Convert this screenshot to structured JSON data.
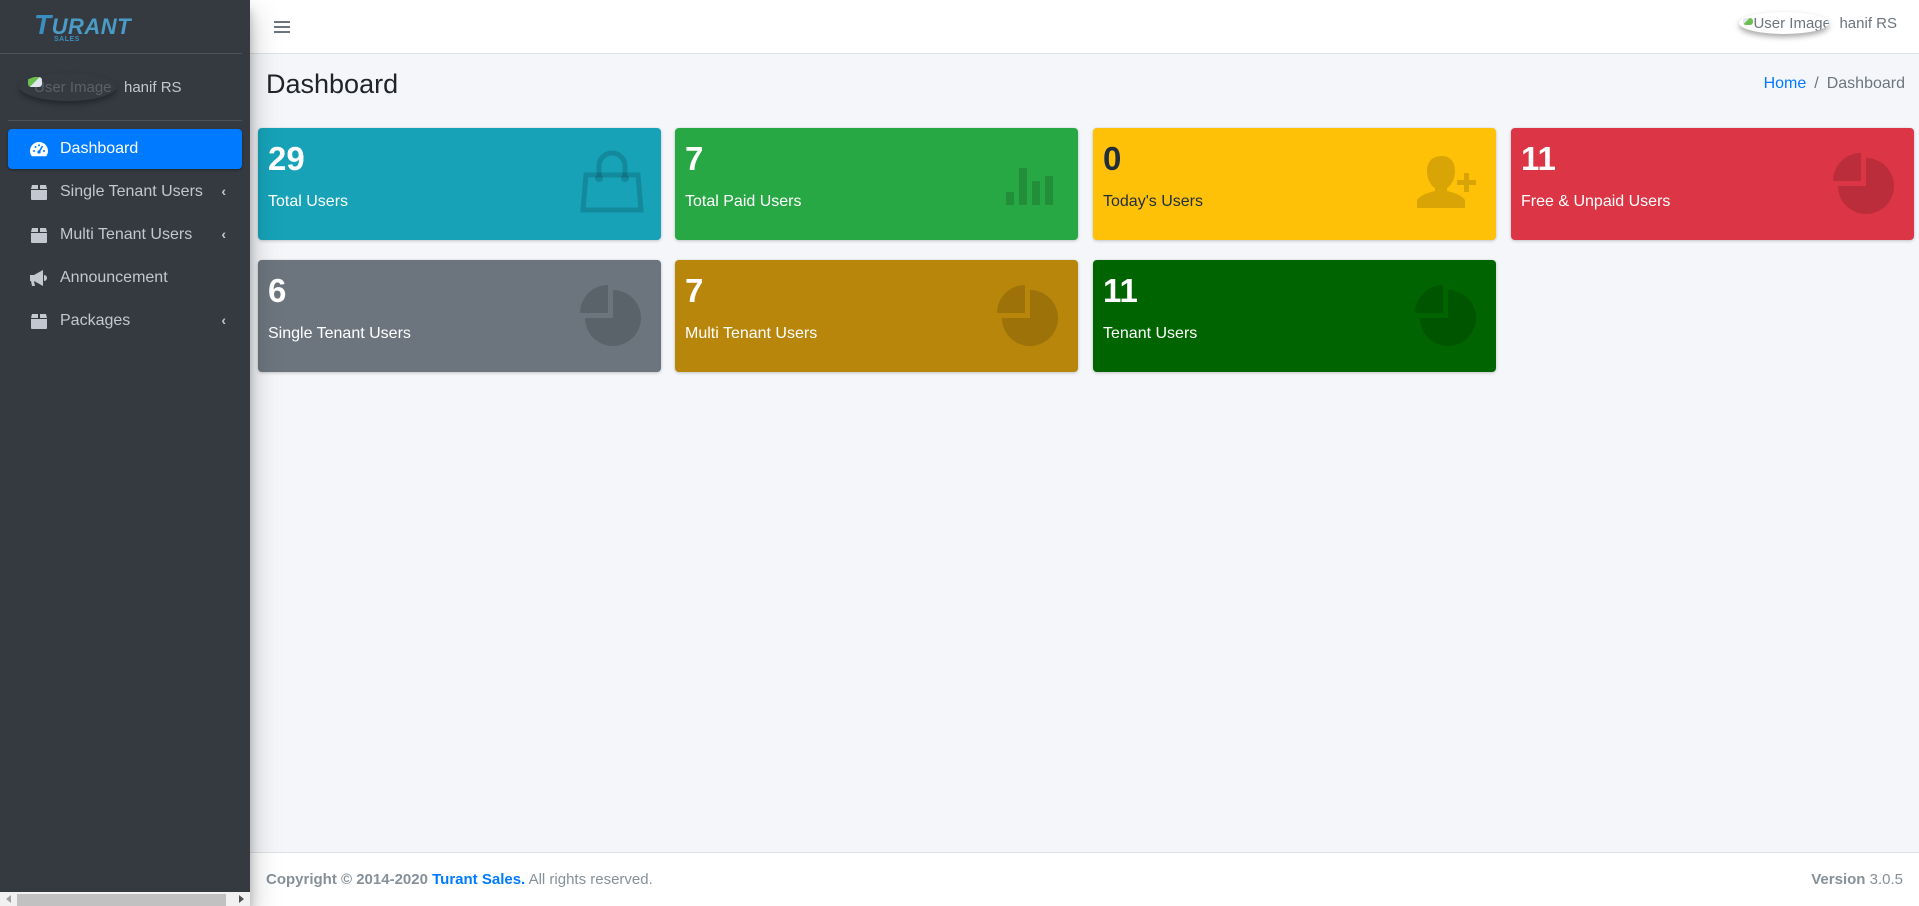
{
  "brand": {
    "name": "TURANT",
    "sub": "SALES"
  },
  "user": {
    "image_alt": "User Image",
    "name": "hanif RS"
  },
  "sidebar": {
    "items": [
      {
        "label": "Dashboard",
        "icon": "tachometer-icon",
        "active": true,
        "has_arrow": false
      },
      {
        "label": "Single Tenant Users",
        "icon": "box-icon",
        "active": false,
        "has_arrow": true
      },
      {
        "label": "Multi Tenant Users",
        "icon": "box-icon",
        "active": false,
        "has_arrow": true
      },
      {
        "label": "Announcement",
        "icon": "bullhorn-icon",
        "active": false,
        "has_arrow": false
      },
      {
        "label": "Packages",
        "icon": "box-icon",
        "active": false,
        "has_arrow": true
      }
    ],
    "arrow_glyph": "‹"
  },
  "header": {
    "user_image_alt": "User Image",
    "user_name": "hanif RS"
  },
  "page": {
    "title": "Dashboard",
    "breadcrumb": {
      "home": "Home",
      "separator": "/",
      "current": "Dashboard"
    }
  },
  "cards": [
    {
      "value": "29",
      "label": "Total Users",
      "color": "#17a2b8",
      "icon": "shopping-bag-icon"
    },
    {
      "value": "7",
      "label": "Total Paid Users",
      "color": "#28a745",
      "icon": "bar-chart-icon"
    },
    {
      "value": "0",
      "label": "Today's Users",
      "color": "#ffc107",
      "icon": "user-plus-icon"
    },
    {
      "value": "11",
      "label": "Free & Unpaid Users",
      "color": "#dc3545",
      "icon": "pie-chart-icon"
    },
    {
      "value": "6",
      "label": "Single Tenant Users",
      "color": "#6c757d",
      "icon": "pie-chart-icon"
    },
    {
      "value": "7",
      "label": "Multi Tenant Users",
      "color": "#b8860b",
      "icon": "pie-chart-icon"
    },
    {
      "value": "11",
      "label": "Tenant Users",
      "color": "#006400",
      "icon": "pie-chart-icon"
    }
  ],
  "footer": {
    "copyright_prefix": "Copyright © 2014-2020",
    "brand_link": "Turant Sales.",
    "suffix": "All rights reserved.",
    "version_label": "Version",
    "version_value": "3.0.5"
  }
}
